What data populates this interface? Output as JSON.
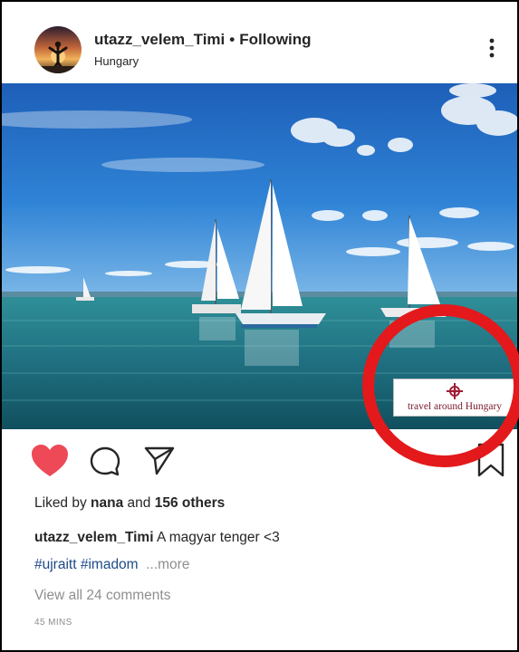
{
  "post": {
    "author": "utazz_velem_Timi",
    "separator": "•",
    "follow_status": "Following",
    "location": "Hungary",
    "image_alt": "Sailboats on Lake Balaton",
    "watermark": "travel around Hungary",
    "liked_prefix": "Liked by",
    "liked_user": "nana",
    "liked_joiner": "and",
    "liked_others": "156 others",
    "caption_author": "utazz_velem_Timi",
    "caption_text": "A magyar tenger <3",
    "hashtags": [
      "#ujraitt",
      "#imadom"
    ],
    "more_label": "...more",
    "view_comments": "View all 24 comments",
    "timestamp": "45 MINS"
  },
  "icons": {
    "like": "heart-icon",
    "comment": "comment-icon",
    "share": "send-icon",
    "save": "bookmark-icon",
    "options": "more-options-icon"
  },
  "colors": {
    "like_active": "#ed4956",
    "highlight_ring": "#e3191b",
    "hashtag": "#1e4a89",
    "muted": "#8e8e8e"
  }
}
